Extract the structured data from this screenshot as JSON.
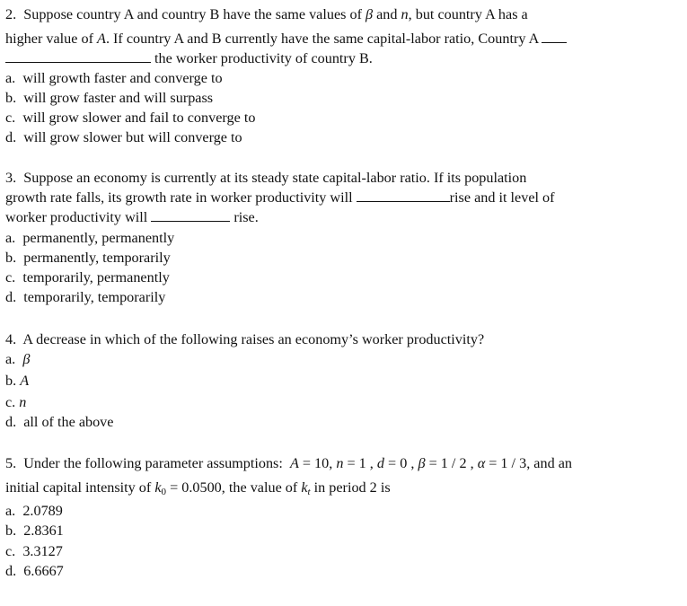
{
  "questions": [
    {
      "number": "2.",
      "stem": {
        "l1a": "Suppose country A and country B have the same values of ",
        "beta": "β",
        "l1b": " and ",
        "n": "n",
        "l1c": ", but country A has a",
        "l2a": "higher value of ",
        "A": "A",
        "l2b": ".  If country A and B currently have the same capital-labor ratio, Country A ",
        "l3": "the worker productivity of country B."
      },
      "options": [
        {
          "letter": "a.",
          "text": "will growth faster and converge to"
        },
        {
          "letter": "b.",
          "text": "will grow faster and will surpass"
        },
        {
          "letter": "c.",
          "text": "will grow slower and fail to converge to"
        },
        {
          "letter": "d.",
          "text": "will grow slower but will converge to"
        }
      ]
    },
    {
      "number": "3.",
      "stem": {
        "l1": "Suppose an economy is currently at its steady state capital-labor ratio.  If its population",
        "l2a": "growth rate falls, its growth rate in worker productivity will ",
        "l2b": "rise and it level of",
        "l3a": "worker productivity will ",
        "l3b": " rise."
      },
      "options": [
        {
          "letter": "a.",
          "text": "permanently, permanently"
        },
        {
          "letter": "b.",
          "text": "permanently, temporarily"
        },
        {
          "letter": "c.",
          "text": "temporarily, permanently"
        },
        {
          "letter": "d.",
          "text": "temporarily, temporarily"
        }
      ]
    },
    {
      "number": "4.",
      "stem": "A decrease in which of the following raises an economy’s worker productivity?",
      "options": [
        {
          "letter": "a.",
          "text": "β",
          "italic": true
        },
        {
          "letter": "b.",
          "text": "A",
          "italic": true
        },
        {
          "letter": "c.",
          "text": "n",
          "italic": true
        },
        {
          "letter": "d.",
          "text": "all of the above"
        }
      ]
    },
    {
      "number": "5.",
      "stem": {
        "l1a": "Under the following parameter assumptions: ",
        "p1": "A",
        "p1v": " = 10, ",
        "p2": "n",
        "p2v": " = 1 ,  ",
        "p3": "d",
        "p3v": " = 0 ,  ",
        "p4": "β",
        "p4v": " = 1 / 2 ,  ",
        "p5": "α",
        "p5v": " = 1 / 3",
        "l1b": ", and an",
        "l2a": "initial capital intensity of ",
        "k": "k",
        "k0sub": "0",
        "k0v": " = 0.0500",
        "l2b": ", the value of ",
        "ktsub": "t",
        "l2c": "  in period 2 is"
      },
      "options": [
        {
          "letter": "a.",
          "text": "2.0789"
        },
        {
          "letter": "b.",
          "text": "2.8361"
        },
        {
          "letter": "c.",
          "text": "3.3127"
        },
        {
          "letter": "d.",
          "text": "6.6667"
        }
      ]
    }
  ]
}
